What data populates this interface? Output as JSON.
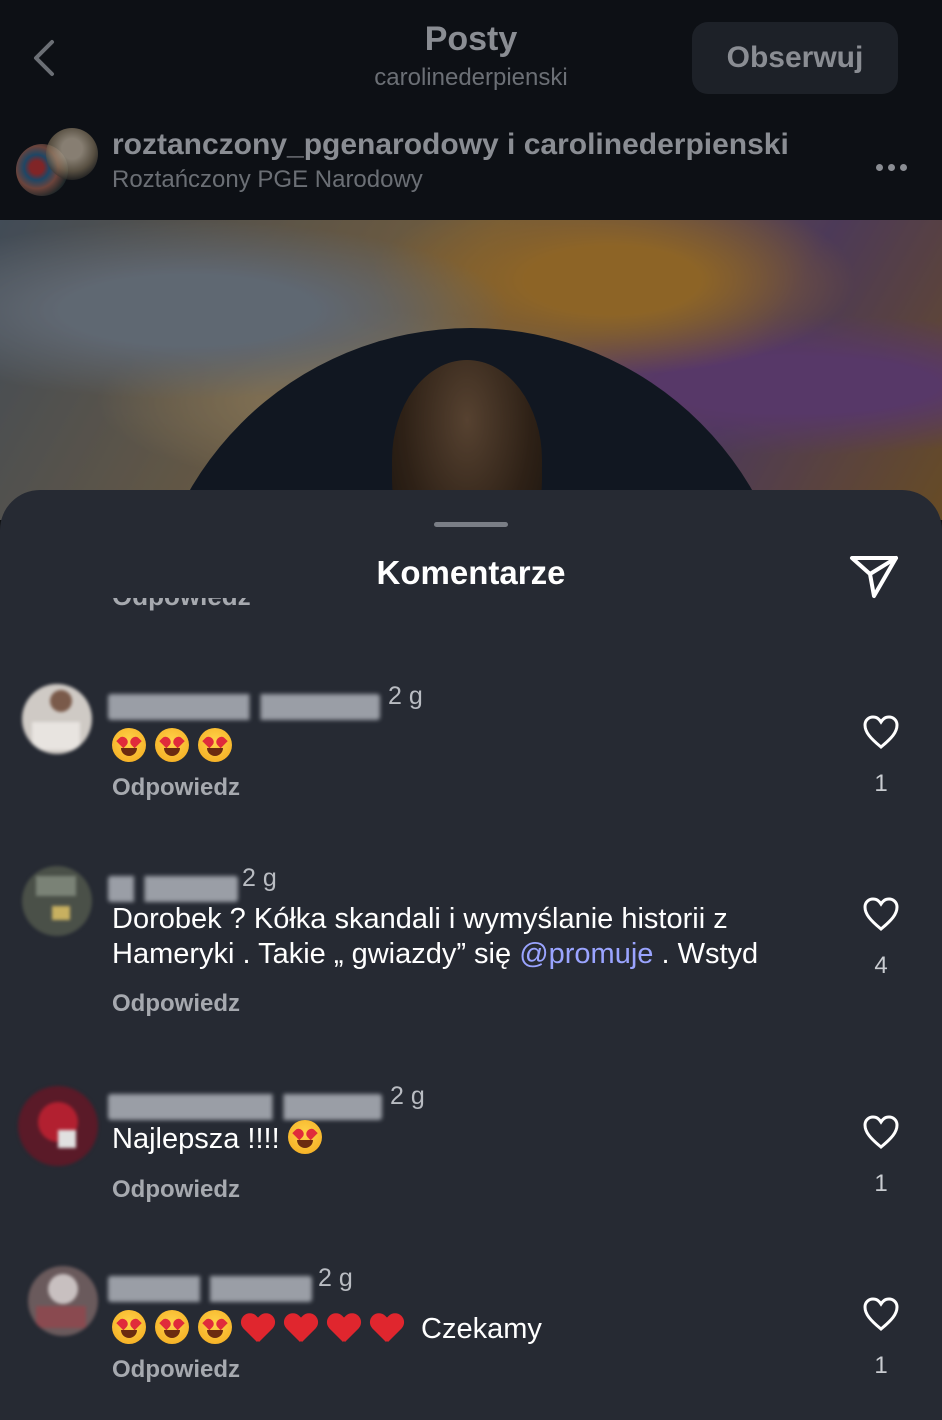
{
  "header": {
    "title": "Posty",
    "subtitle": "carolinederpienski",
    "follow_label": "Obserwuj"
  },
  "post": {
    "users": "roztanczony_pgenarodowy i carolinederpienski",
    "location": "Roztańczony PGE Narodowy"
  },
  "sheet": {
    "title": "Komentarze",
    "clipped_text": "Odpowiedz"
  },
  "comments": [
    {
      "time": "2 g",
      "text": "",
      "emoji": [
        "heart-eyes",
        "heart-eyes",
        "heart-eyes"
      ],
      "reply": "Odpowiedz",
      "likes": "1"
    },
    {
      "time": "2 g",
      "text_before": "Dorobek ? Kółka skandali i wymyślanie historii z Hameryki . Takie „ gwiazdy” się ",
      "mention": "@promuje",
      "text_after": " . Wstyd",
      "reply": "Odpowiedz",
      "likes": "4"
    },
    {
      "time": "2 g",
      "text": "Najlepsza !!!! ",
      "emoji": [
        "heart-eyes"
      ],
      "reply": "Odpowiedz",
      "likes": "1"
    },
    {
      "time": "2 g",
      "text": " Czekamy",
      "emoji": [
        "heart-eyes",
        "heart-eyes",
        "heart-eyes",
        "red-heart",
        "red-heart",
        "red-heart",
        "red-heart"
      ],
      "reply": "Odpowiedz",
      "likes": "1"
    }
  ],
  "icons": {
    "back": "chevron-left-icon",
    "more": "more-dots-icon",
    "send": "send-icon",
    "like": "heart-outline-icon"
  },
  "colors": {
    "sheet_bg": "#262a33",
    "mention": "#9aa4ff",
    "header_bg": "#0d1015"
  }
}
